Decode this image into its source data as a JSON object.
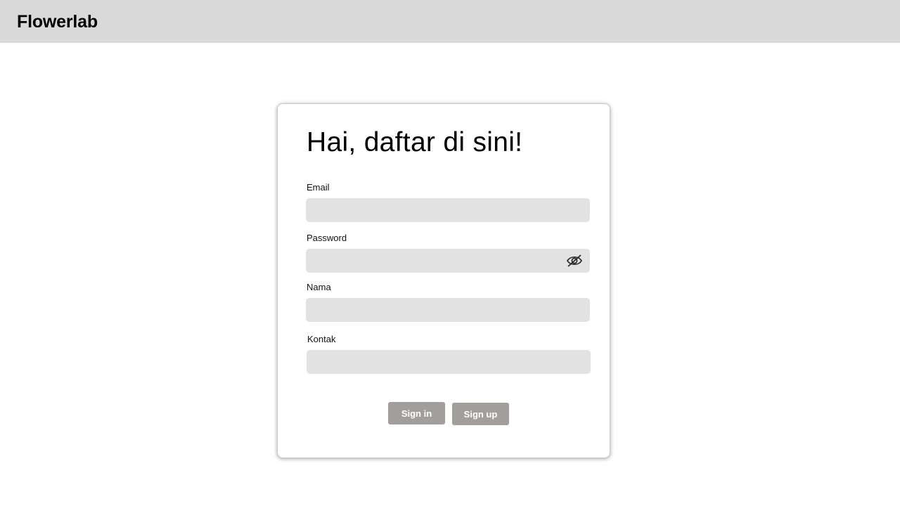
{
  "header": {
    "brand": "Flowerlab"
  },
  "form": {
    "heading": "Hai, daftar di sini!",
    "fields": [
      {
        "label": "Email",
        "value": "",
        "placeholder": ""
      },
      {
        "label": "Password",
        "value": "",
        "placeholder": "",
        "icon": "eye-off-icon"
      },
      {
        "label": "Nama",
        "value": "",
        "placeholder": ""
      },
      {
        "label": "Kontak",
        "value": "",
        "placeholder": ""
      }
    ],
    "buttons": {
      "sign_in": "Sign in",
      "sign_up": "Sign up"
    }
  },
  "colors": {
    "topbar": "#d9d9d9",
    "field_bg": "#e2e2e2",
    "button_bg": "#a39e9e",
    "button_text": "#ffffff"
  }
}
